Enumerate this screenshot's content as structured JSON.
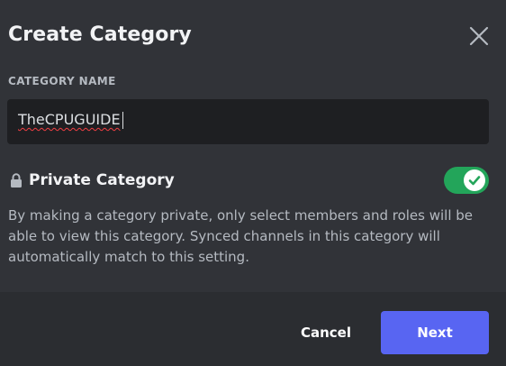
{
  "dialog": {
    "title": "Create Category",
    "close_icon": "close-icon"
  },
  "category_name": {
    "label": "CATEGORY NAME",
    "value": "TheCPUGUIDE"
  },
  "private_category": {
    "icon": "lock-icon",
    "label": "Private Category",
    "enabled": true,
    "description": "By making a category private, only select members and roles will be able to view this category. Synced channels in this category will automatically match to this setting."
  },
  "footer": {
    "cancel_label": "Cancel",
    "next_label": "Next"
  },
  "colors": {
    "background": "#313338",
    "footer_background": "#2b2d31",
    "input_background": "#1e1f22",
    "toggle_on": "#23a55a",
    "primary_button": "#5865f2",
    "spellcheck_underline": "#f23f43"
  }
}
